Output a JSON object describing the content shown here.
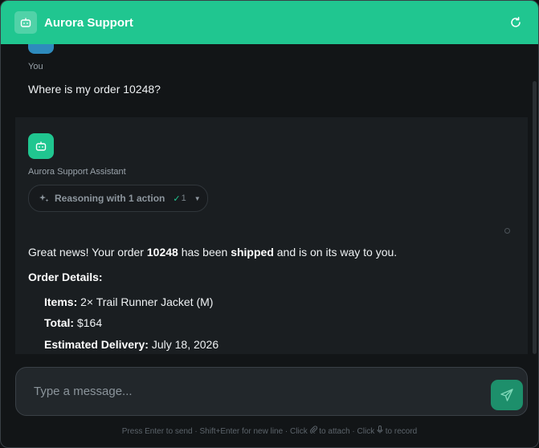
{
  "header": {
    "title": "Aurora Support",
    "bot_icon": "robot-icon",
    "refresh_icon": "refresh-icon",
    "background_color": "#20c690"
  },
  "messages": {
    "user": {
      "sender": "You",
      "text": "Where is my order 10248?"
    },
    "assistant": {
      "sender": "Aurora Support Assistant",
      "reasoning": {
        "label": "Reasoning with 1 action",
        "check": "✓",
        "count": "1"
      },
      "answer": {
        "prefix": "Great news! Your order ",
        "order_number": "10248",
        "middle": " has been ",
        "status": "shipped",
        "suffix": " and is on its way to you."
      },
      "details_title": "Order Details:",
      "details": [
        {
          "label": "Items:",
          "value": " 2× Trail Runner Jacket (M)"
        },
        {
          "label": "Total:",
          "value": " $164"
        },
        {
          "label": "Estimated Delivery:",
          "value": " July 18, 2026"
        }
      ]
    }
  },
  "composer": {
    "placeholder": "Type a message...",
    "value": "",
    "send_icon": "send-icon"
  },
  "hint": {
    "part1": "Press Enter to send · Shift+Enter for new line · Click ",
    "attach_icon": "paperclip-icon",
    "part2": " to attach · Click ",
    "mic_icon": "microphone-icon",
    "part3": " to record"
  }
}
